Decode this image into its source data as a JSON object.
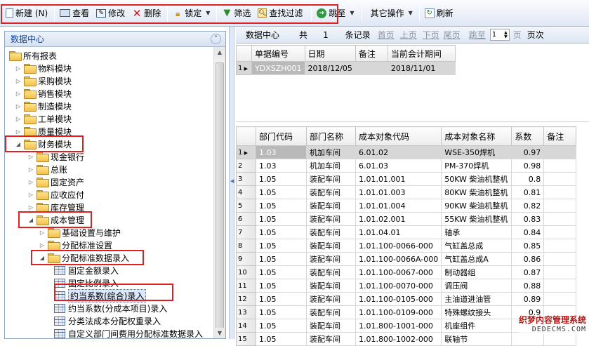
{
  "toolbar": {
    "new_label": "新建 (N)",
    "view_label": "查看",
    "edit_label": "修改",
    "delete_label": "删除",
    "lock_label": "锁定",
    "filter_label": "筛选",
    "find_filter_label": "查找过滤",
    "jump_label": "跳至",
    "other_ops_label": "其它操作",
    "refresh_label": "刷新"
  },
  "left_panel": {
    "title": "数据中心",
    "tree": [
      {
        "label": "所有报表",
        "icon": "folder-icon",
        "arrow": "",
        "level": 0
      },
      {
        "label": "物料模块",
        "icon": "folder-icon",
        "arrow": "▷",
        "level": 1
      },
      {
        "label": "采购模块",
        "icon": "folder-icon",
        "arrow": "▷",
        "level": 1
      },
      {
        "label": "销售模块",
        "icon": "folder-icon",
        "arrow": "▷",
        "level": 1
      },
      {
        "label": "制造模块",
        "icon": "folder-icon",
        "arrow": "▷",
        "level": 1
      },
      {
        "label": "工单模块",
        "icon": "folder-icon",
        "arrow": "▷",
        "level": 1
      },
      {
        "label": "质量模块",
        "icon": "folder-icon",
        "arrow": "▷",
        "level": 1
      },
      {
        "label": "财务模块",
        "icon": "folder-icon",
        "arrow": "◢",
        "level": 1
      },
      {
        "label": "现金银行",
        "icon": "folder-icon",
        "arrow": "▷",
        "level": 2
      },
      {
        "label": "总账",
        "icon": "folder-icon",
        "arrow": "▷",
        "level": 2
      },
      {
        "label": "固定资产",
        "icon": "folder-icon",
        "arrow": "▷",
        "level": 2
      },
      {
        "label": "应收应付",
        "icon": "folder-icon",
        "arrow": "▷",
        "level": 2
      },
      {
        "label": "库存管理",
        "icon": "folder-icon",
        "arrow": "▷",
        "level": 2
      },
      {
        "label": "成本管理",
        "icon": "folder-icon",
        "arrow": "◢",
        "level": 2
      },
      {
        "label": "基础设置与维护",
        "icon": "folder-icon",
        "arrow": "▷",
        "level": 3
      },
      {
        "label": "分配标准设置",
        "icon": "folder-icon",
        "arrow": "▷",
        "level": 3
      },
      {
        "label": "分配标准数据录入",
        "icon": "folder-icon",
        "arrow": "◢",
        "level": 3
      },
      {
        "label": "固定金额录入",
        "icon": "grid-icon",
        "arrow": "",
        "level": 4
      },
      {
        "label": "固定比例录入",
        "icon": "grid-icon",
        "arrow": "",
        "level": 4
      },
      {
        "label": "约当系数(综合)录入",
        "icon": "grid-icon",
        "arrow": "",
        "level": 4,
        "selected": true
      },
      {
        "label": "约当系数(分成本项目)录入",
        "icon": "grid-icon",
        "arrow": "",
        "level": 4
      },
      {
        "label": "分类法成本分配权重录入",
        "icon": "grid-icon",
        "arrow": "",
        "level": 4
      },
      {
        "label": "自定义部门间费用分配标准数据录入",
        "icon": "grid-icon",
        "arrow": "",
        "level": 4
      }
    ]
  },
  "nav": {
    "title": "数据中心",
    "total_label": "共",
    "total_value": "1",
    "records_label": "条记录",
    "first": "首页",
    "prev": "上页",
    "next": "下页",
    "last": "尾页",
    "goto_label": "跳至",
    "page_value": "1",
    "page_suffix": "页",
    "page_count": "页次"
  },
  "master_table": {
    "headers": [
      "单据编号",
      "日期",
      "备注",
      "当前会计期间"
    ],
    "rows": [
      {
        "rn": "1",
        "cells": [
          "YDXSZH001",
          "2018/12/05",
          "",
          "2018/11/01"
        ]
      }
    ]
  },
  "detail_table": {
    "headers": [
      "部门代码",
      "部门名称",
      "成本对象代码",
      "成本对象名称",
      "系数",
      "备注"
    ],
    "rows": [
      {
        "rn": "1",
        "cells": [
          "1.03",
          "机加车间",
          "6.01.02",
          "WSE-350焊机",
          "0.97",
          ""
        ]
      },
      {
        "rn": "2",
        "cells": [
          "1.03",
          "机加车间",
          "6.01.03",
          "PM-370焊机",
          "0.98",
          ""
        ]
      },
      {
        "rn": "3",
        "cells": [
          "1.05",
          "装配车间",
          "1.01.01.001",
          "50KW 柴油机整机",
          "0.8",
          ""
        ]
      },
      {
        "rn": "4",
        "cells": [
          "1.05",
          "装配车间",
          "1.01.01.003",
          "80KW 柴油机整机",
          "0.81",
          ""
        ]
      },
      {
        "rn": "5",
        "cells": [
          "1.05",
          "装配车间",
          "1.01.01.004",
          "90KW 柴油机整机",
          "0.82",
          ""
        ]
      },
      {
        "rn": "6",
        "cells": [
          "1.05",
          "装配车间",
          "1.01.02.001",
          "55KW 柴油机整机",
          "0.83",
          ""
        ]
      },
      {
        "rn": "7",
        "cells": [
          "1.05",
          "装配车间",
          "1.01.04.01",
          "轴承",
          "0.84",
          ""
        ]
      },
      {
        "rn": "8",
        "cells": [
          "1.05",
          "装配车间",
          "1.01.100-0066-000",
          "气缸盖总成",
          "0.85",
          ""
        ]
      },
      {
        "rn": "9",
        "cells": [
          "1.05",
          "装配车间",
          "1.01.100-0066A-000",
          "气缸盖总成A",
          "0.86",
          ""
        ]
      },
      {
        "rn": "10",
        "cells": [
          "1.05",
          "装配车间",
          "1.01.100-0067-000",
          "制动器组",
          "0.87",
          ""
        ]
      },
      {
        "rn": "11",
        "cells": [
          "1.05",
          "装配车间",
          "1.01.100-0070-000",
          "调压阀",
          "0.88",
          ""
        ]
      },
      {
        "rn": "12",
        "cells": [
          "1.05",
          "装配车间",
          "1.01.100-0105-000",
          "主油道进油管",
          "0.89",
          ""
        ]
      },
      {
        "rn": "13",
        "cells": [
          "1.05",
          "装配车间",
          "1.01.100-0109-000",
          "特殊螺纹接头",
          "0.9",
          ""
        ]
      },
      {
        "rn": "14",
        "cells": [
          "1.05",
          "装配车间",
          "1.01.800-1001-000",
          "机座组件",
          "",
          ""
        ]
      },
      {
        "rn": "15",
        "cells": [
          "1.05",
          "装配车间",
          "1.01.800-1002-000",
          "联轴节",
          "",
          ""
        ]
      }
    ]
  },
  "watermark": {
    "line1": "织梦内容管理系统",
    "line2": "DEDECMS.COM"
  },
  "colors": {
    "highlight_box": "#e02020",
    "header_blue": "#15428b"
  }
}
